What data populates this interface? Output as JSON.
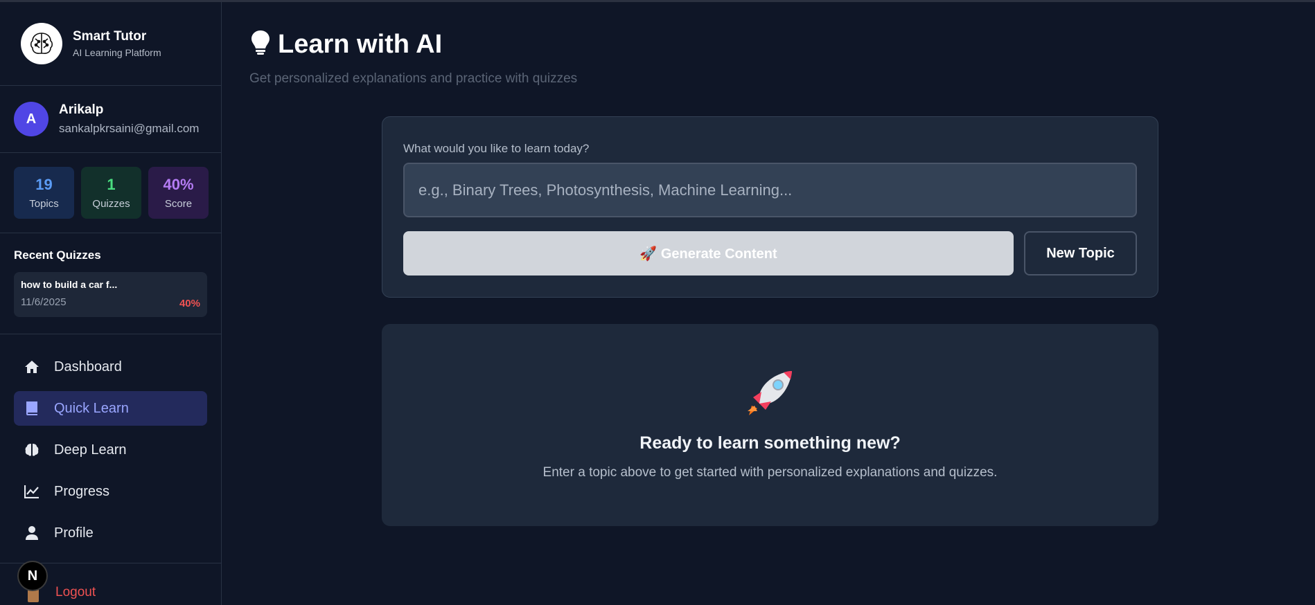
{
  "brand": {
    "title": "Smart Tutor",
    "subtitle": "AI Learning Platform"
  },
  "user": {
    "initial": "A",
    "name": "Arikalp",
    "email": "sankalpkrsaini@gmail.com"
  },
  "stats": [
    {
      "value": "19",
      "label": "Topics",
      "color": "#5b9cf6"
    },
    {
      "value": "1",
      "label": "Quizzes",
      "color": "#4ade80"
    },
    {
      "value": "40%",
      "label": "Score",
      "color": "#b57cf5"
    }
  ],
  "recent": {
    "title": "Recent Quizzes",
    "items": [
      {
        "name": "how to build a car f...",
        "date": "11/6/2025",
        "score": "40%"
      }
    ]
  },
  "nav": {
    "items": [
      {
        "label": "Dashboard",
        "icon": "home-icon"
      },
      {
        "label": "Quick Learn",
        "icon": "book-icon",
        "active": true
      },
      {
        "label": "Deep Learn",
        "icon": "brain-icon"
      },
      {
        "label": "Progress",
        "icon": "chart-icon"
      },
      {
        "label": "Profile",
        "icon": "user-icon"
      }
    ],
    "logout": "Logout"
  },
  "main": {
    "title": "Learn with AI",
    "subtitle": "Get personalized explanations and practice with quizzes",
    "input_label": "What would you like to learn today?",
    "input_placeholder": "e.g., Binary Trees, Photosynthesis, Machine Learning...",
    "generate_label": "🚀 Generate Content",
    "new_topic_label": "New Topic",
    "empty_title": "Ready to learn something new?",
    "empty_desc": "Enter a topic above to get started with personalized explanations and quizzes."
  },
  "dev_badge": "N"
}
